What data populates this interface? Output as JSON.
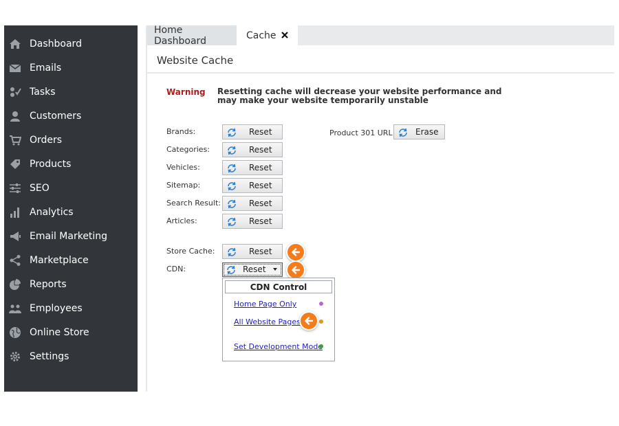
{
  "sidebar": {
    "items": [
      {
        "label": "Dashboard",
        "icon": "home-icon"
      },
      {
        "label": "Emails",
        "icon": "envelope-icon"
      },
      {
        "label": "Tasks",
        "icon": "tasks-icon"
      },
      {
        "label": "Customers",
        "icon": "user-icon"
      },
      {
        "label": "Orders",
        "icon": "cart-icon"
      },
      {
        "label": "Products",
        "icon": "tag-icon"
      },
      {
        "label": "SEO",
        "icon": "sliders-icon"
      },
      {
        "label": "Analytics",
        "icon": "bar-chart-icon"
      },
      {
        "label": "Email Marketing",
        "icon": "megaphone-icon"
      },
      {
        "label": "Marketplace",
        "icon": "share-icon"
      },
      {
        "label": "Reports",
        "icon": "pie-chart-icon"
      },
      {
        "label": "Employees",
        "icon": "users-icon"
      },
      {
        "label": "Online Store",
        "icon": "globe-icon"
      },
      {
        "label": "Settings",
        "icon": "gear-icon"
      }
    ]
  },
  "tabs": {
    "home": "Home Dashboard",
    "cache": "Cache"
  },
  "page": {
    "title": "Website Cache",
    "warning_label": "Warning",
    "warning_text": "Resetting cache will decrease your website performance and may make your website temporarily unstable"
  },
  "cache_rows": [
    {
      "label": "Brands:",
      "button": "Reset"
    },
    {
      "label": "Categories:",
      "button": "Reset"
    },
    {
      "label": "Vehicles:",
      "button": "Reset"
    },
    {
      "label": "Sitemap:",
      "button": "Reset"
    },
    {
      "label": "Search Result:",
      "button": "Reset"
    },
    {
      "label": "Articles:",
      "button": "Reset"
    }
  ],
  "product301": {
    "label": "Product 301 URL",
    "button": "Erase"
  },
  "store_cache": {
    "label": "Store Cache:",
    "button": "Reset"
  },
  "cdn": {
    "label": "CDN:",
    "button": "Reset",
    "menu_title": "CDN Control",
    "options": [
      {
        "label": "Home Page Only",
        "dot_color": "#b565d9"
      },
      {
        "label": "All Website Pages",
        "dot_color": "#e0962b"
      },
      {
        "label": "Set Development Mode",
        "dot_color": "#3aa335"
      }
    ]
  },
  "colors": {
    "sidebar_bg": "#32363b",
    "warning": "#b31b1b",
    "callout": "#f57c1c",
    "link": "#1f1fb8"
  }
}
